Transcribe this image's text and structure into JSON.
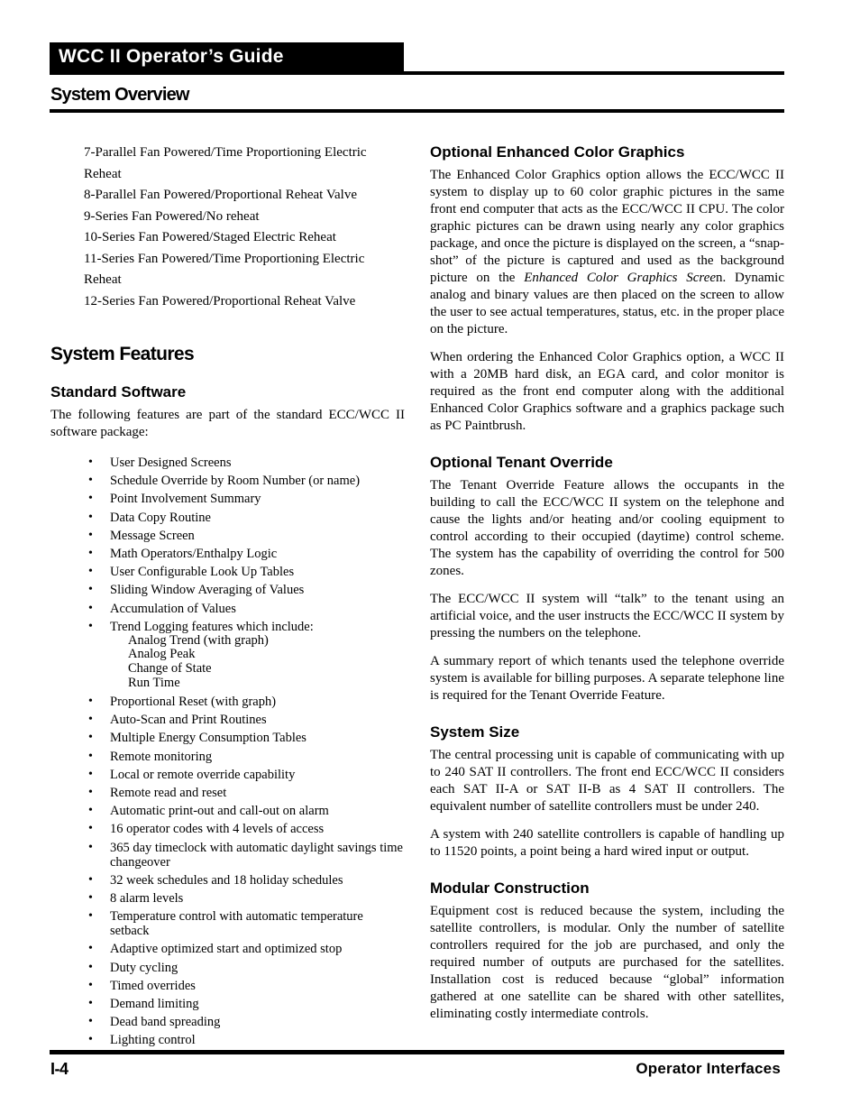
{
  "header": {
    "guide_title": "WCC II Operator’s Guide",
    "section_title": "System Overview"
  },
  "left": {
    "box_types": [
      "7-Parallel Fan Powered/Time Proportioning Electric Reheat",
      "8-Parallel Fan Powered/Proportional Reheat Valve",
      "9-Series Fan Powered/No reheat",
      "10-Series Fan Powered/Staged Electric Reheat",
      "11-Series Fan Powered/Time Proportioning Electric Reheat",
      "12-Series Fan Powered/Proportional Reheat Valve"
    ],
    "features_heading": "System Features",
    "standard_software_heading": "Standard Software",
    "intro": "The following features are part of the standard ECC/WCC II software package:",
    "bullet_glyph": "•",
    "features": [
      {
        "text": "User Designed Screens"
      },
      {
        "text": "Schedule Override by Room Number (or name)"
      },
      {
        "text": "Point Involvement Summary"
      },
      {
        "text": "Data Copy Routine"
      },
      {
        "text": "Message Screen"
      },
      {
        "text": "Math Operators/Enthalpy Logic"
      },
      {
        "text": "User Configurable Look Up Tables"
      },
      {
        "text": "Sliding Window Averaging of Values"
      },
      {
        "text": "Accumulation of Values"
      },
      {
        "text": "Trend Logging features which include:",
        "sub": [
          "Analog Trend (with graph)",
          "Analog Peak",
          "Change of State",
          "Run Time"
        ]
      },
      {
        "text": "Proportional Reset (with graph)"
      },
      {
        "text": "Auto-Scan and Print Routines"
      },
      {
        "text": "Multiple Energy Consumption Tables"
      },
      {
        "text": "Remote monitoring"
      },
      {
        "text": "Local or remote override capability"
      },
      {
        "text": "Remote read and reset"
      },
      {
        "text": "Automatic print-out and call-out on alarm"
      },
      {
        "text": "16 operator codes with 4 levels of access"
      },
      {
        "text": "365 day timeclock with automatic daylight savings time changeover"
      },
      {
        "text": "32 week schedules and 18 holiday schedules"
      },
      {
        "text": "8 alarm levels"
      },
      {
        "text": "Temperature control with automatic temperature setback"
      },
      {
        "text": "Adaptive optimized start and optimized stop"
      },
      {
        "text": "Duty cycling"
      },
      {
        "text": "Timed overrides"
      },
      {
        "text": "Demand limiting"
      },
      {
        "text": "Dead band spreading"
      },
      {
        "text": "Lighting control"
      }
    ]
  },
  "right": {
    "sections": [
      {
        "heading": "Optional Enhanced Color Graphics",
        "paragraphs": [
          {
            "before": "The Enhanced Color Graphics option allows the ECC/WCC II system to display up to 60 color graphic pictures in the same front end computer that acts as the ECC/WCC II CPU. The color graphic pictures can be drawn using nearly any color graphics package, and once the picture is displayed on the screen, a “snap-shot” of the picture is captured and used as the background picture on the ",
            "italic": "Enhanced Color Graphics Scree",
            "after": "n. Dynamic analog and binary values are then placed on the screen to allow the user to see actual temperatures, status, etc. in the proper place on the picture."
          },
          {
            "before": "When ordering the Enhanced Color Graphics option, a WCC II with a 20MB hard disk, an EGA card, and color monitor is required as the front end computer along with the additional Enhanced Color Graphics software and a graphics package such as PC Paintbrush."
          }
        ]
      },
      {
        "heading": "Optional Tenant Override",
        "paragraphs": [
          {
            "before": "The Tenant Override Feature allows the occupants in the building to call the ECC/WCC II system on the telephone and cause the lights and/or heating and/or cooling equipment to control according to their occupied (daytime) control scheme. The system has the capability of overriding the control for 500 zones."
          },
          {
            "before": "The ECC/WCC II system will “talk” to the tenant using an artificial voice, and the user instructs the ECC/WCC II system by pressing the numbers on the telephone."
          },
          {
            "before": "A summary report of which tenants used the telephone override system is available for billing purposes. A separate telephone line is required for the Tenant Override Feature."
          }
        ]
      },
      {
        "heading": "System Size",
        "paragraphs": [
          {
            "before": "The central processing unit is capable of communicating with up to 240 SAT II controllers. The front end ECC/WCC II considers each SAT II-A or SAT II-B as 4 SAT II controllers. The equivalent number of satellite controllers must be under 240."
          },
          {
            "before": "A system with 240 satellite controllers is capable of handling up to 11520 points, a point being a hard wired input or output."
          }
        ]
      },
      {
        "heading": "Modular Construction",
        "paragraphs": [
          {
            "before": "Equipment cost is reduced because the system, including the satellite controllers, is modular. Only the number of satellite controllers required for the job are purchased, and only the required number of outputs are purchased for the satellites. Installation cost is reduced because “global” information gathered at one satellite can be shared with other satellites, eliminating costly intermediate controls."
          }
        ]
      }
    ]
  },
  "footer": {
    "page_number": "I-4",
    "chapter": "Operator Interfaces"
  }
}
